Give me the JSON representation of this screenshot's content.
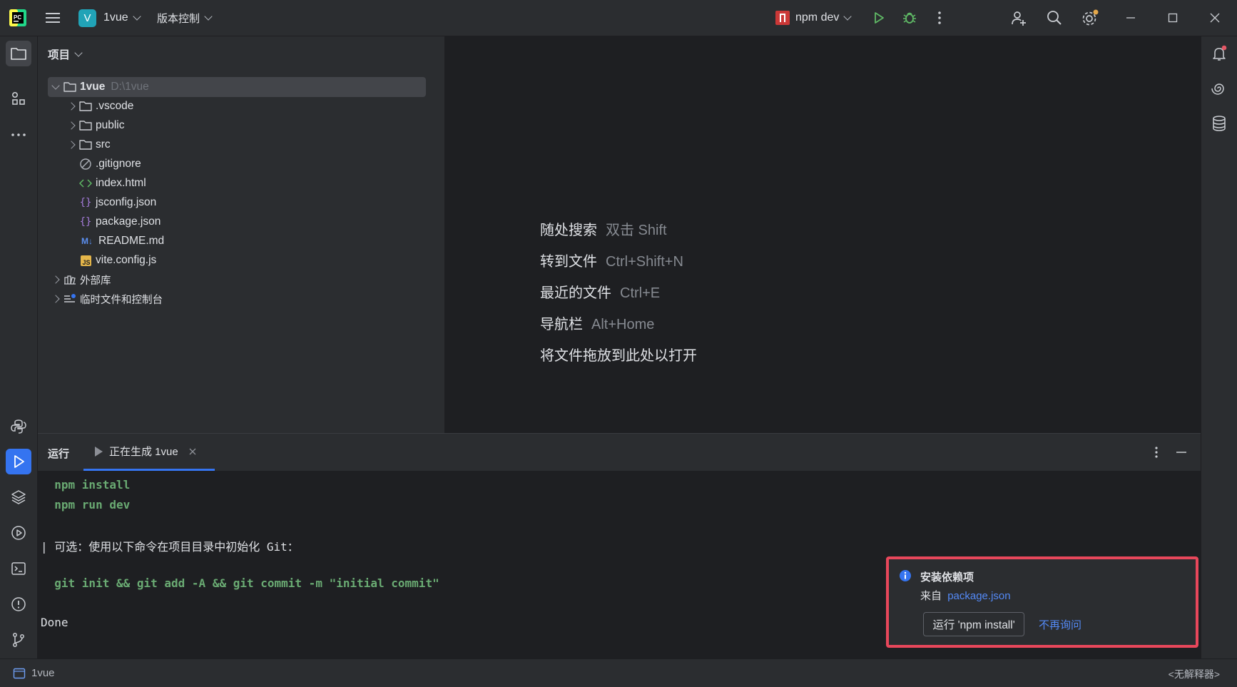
{
  "titlebar": {
    "project_badge": "V",
    "project_name": "1vue",
    "vcs_label": "版本控制",
    "run_config": "npm dev"
  },
  "project_panel": {
    "title": "项目",
    "root": {
      "name": "1vue",
      "path": "D:\\1vue"
    },
    "items": [
      {
        "label": ".vscode",
        "type": "folder"
      },
      {
        "label": "public",
        "type": "folder"
      },
      {
        "label": "src",
        "type": "folder"
      },
      {
        "label": ".gitignore",
        "type": "ignore"
      },
      {
        "label": "index.html",
        "type": "html"
      },
      {
        "label": "jsconfig.json",
        "type": "json"
      },
      {
        "label": "package.json",
        "type": "json"
      },
      {
        "label": "README.md",
        "type": "md"
      },
      {
        "label": "vite.config.js",
        "type": "js"
      }
    ],
    "external_libs": "外部库",
    "scratches": "临时文件和控制台"
  },
  "editor": {
    "hints": [
      {
        "label": "随处搜索",
        "key": "双击 Shift"
      },
      {
        "label": "转到文件",
        "key": "Ctrl+Shift+N"
      },
      {
        "label": "最近的文件",
        "key": "Ctrl+E"
      },
      {
        "label": "导航栏",
        "key": "Alt+Home"
      },
      {
        "label": "将文件拖放到此处以打开",
        "key": ""
      }
    ]
  },
  "run_panel": {
    "title": "运行",
    "tab_label": "正在生成 1vue",
    "console": {
      "line1": "  npm install",
      "line2": "  npm run dev",
      "line3": "| 可选：使用以下命令在项目目录中初始化 Git：",
      "line4": "  git init && git add -A && git commit -m \"initial commit\"",
      "line5": "Done"
    }
  },
  "notification": {
    "title": "安装依赖项",
    "from_prefix": "来自",
    "from_link": "package.json",
    "primary_button": "运行 'npm install'",
    "secondary_link": "不再询问"
  },
  "statusbar": {
    "project": "1vue",
    "interpreter": "<无解释器>"
  },
  "colors": {
    "accent": "#3574f0",
    "console_green": "#6aab73",
    "link": "#548af7",
    "highlight_border": "#e8475b"
  }
}
